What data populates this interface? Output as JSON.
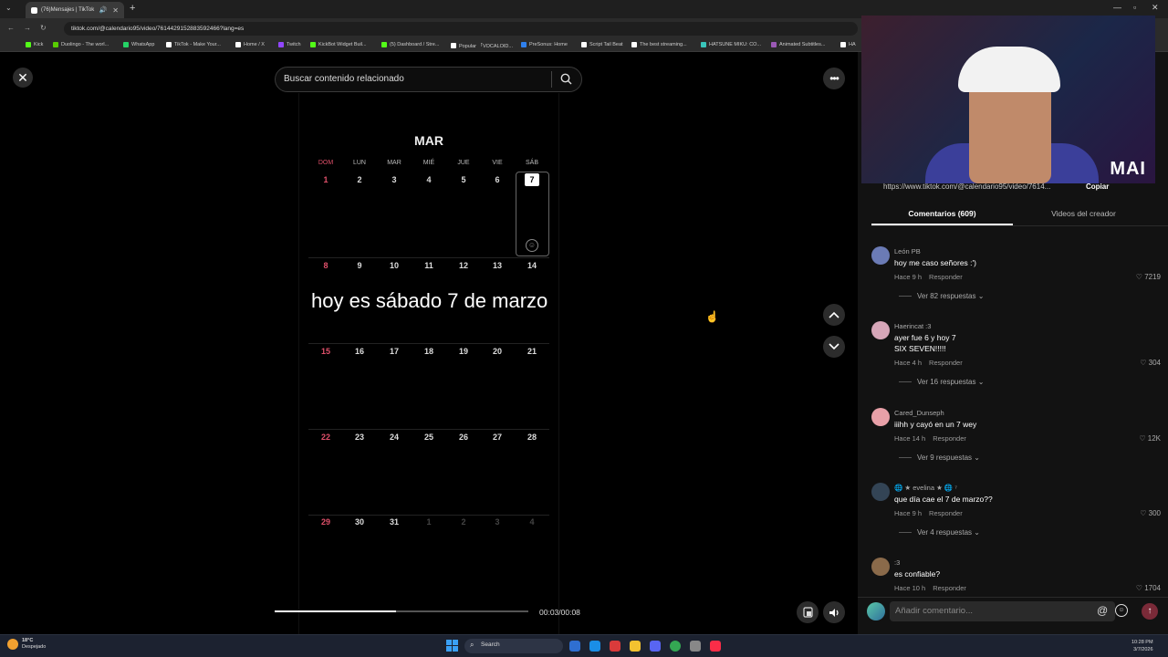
{
  "browser": {
    "tab_title": "(76)Mensajes | TikTok",
    "tab_close": "✕",
    "new_tab": "+",
    "url": "tiktok.com/@calendario95/video/7614429152883592466?lang=es",
    "bookmarks": [
      {
        "label": "Kick",
        "color": "#53fc18"
      },
      {
        "label": "Duolingo - The worl...",
        "color": "#58cc02"
      },
      {
        "label": "WhatsApp",
        "color": "#25d366"
      },
      {
        "label": "TikTok - Make Your...",
        "color": "#ffffff"
      },
      {
        "label": "Home / X",
        "color": "#ffffff"
      },
      {
        "label": "Twitch",
        "color": "#9146ff"
      },
      {
        "label": "KickBot Widget Buil...",
        "color": "#53fc18"
      },
      {
        "label": "(5) Dashboard / Stre...",
        "color": "#53fc18"
      },
      {
        "label": "Popular 「VOCALOID...",
        "color": "#ffffff"
      },
      {
        "label": "PreSonus: Home",
        "color": "#2f80ed"
      },
      {
        "label": "Script Tail Beat",
        "color": "#ffffff"
      },
      {
        "label": "The best streaming...",
        "color": "#ffffff"
      },
      {
        "label": "HATSUNE MIKU: CO...",
        "color": "#39c5bb"
      },
      {
        "label": "Animated Subtitles...",
        "color": "#9b59b6"
      },
      {
        "label": "HA",
        "color": "#ffffff"
      }
    ]
  },
  "search": {
    "placeholder": "Buscar contenido relacionado"
  },
  "calendar": {
    "month": "MAR",
    "weekdays": [
      "DOM",
      "LUN",
      "MAR",
      "MIÉ",
      "JUE",
      "VIE",
      "SÁB"
    ],
    "weeks": [
      [
        "1",
        "2",
        "3",
        "4",
        "5",
        "6",
        "7"
      ],
      [
        "8",
        "9",
        "10",
        "11",
        "12",
        "13",
        "14"
      ],
      [
        "15",
        "16",
        "17",
        "18",
        "19",
        "20",
        "21"
      ],
      [
        "22",
        "23",
        "24",
        "25",
        "26",
        "27",
        "28"
      ],
      [
        "29",
        "30",
        "31",
        "1",
        "2",
        "3",
        "4"
      ]
    ],
    "today": "7",
    "caption": "hoy es sábado 7 de marzo"
  },
  "player": {
    "time": "00:03/00:08",
    "progress": 0.48
  },
  "panel": {
    "link": "https://www.tiktok.com/@calendario95/video/7614...",
    "copy_label": "Copiar",
    "webcam_watermark": "MAI",
    "tab_comments": "Comentarios (609)",
    "tab_videos": "Videos del creador",
    "comments": [
      {
        "user": "León PB",
        "text": "hoy me caso señores :')",
        "time": "Hace 9 h",
        "reply": "Responder",
        "likes": "7219",
        "replies": "Ver 82 respuestas",
        "avatar": "#6b7bb5"
      },
      {
        "user": "Haerincat :3",
        "text": "ayer fue 6 y hoy 7\nSIX SEVEN!!!!!",
        "time": "Hace 4 h",
        "reply": "Responder",
        "likes": "304",
        "replies": "Ver 16 respuestas",
        "avatar": "#d6a6b8"
      },
      {
        "user": "Cared_Dunseph",
        "text": "iiihh y cayó en un 7 wey",
        "time": "Hace 14 h",
        "reply": "Responder",
        "likes": "12K",
        "replies": "Ver 9 respuestas",
        "avatar": "#e8a0a8"
      },
      {
        "user": "🌐 ★ evelina ★ 🌐 ⁷",
        "text": "que día cae el 7 de marzo??",
        "time": "Hace 9 h",
        "reply": "Responder",
        "likes": "300",
        "replies": "Ver 4 respuestas",
        "avatar": "#334455"
      },
      {
        "user": ":3",
        "text": "es confiable?",
        "time": "Hace 10 h",
        "reply": "Responder",
        "likes": "1704",
        "replies": "",
        "avatar": "#8a6a4a"
      }
    ],
    "comment_placeholder": "Añadir comentario..."
  },
  "taskbar": {
    "temp": "18°C",
    "weather": "Despejado",
    "search": "Search",
    "time": "10:28 PM",
    "date": "3/7/2026"
  }
}
